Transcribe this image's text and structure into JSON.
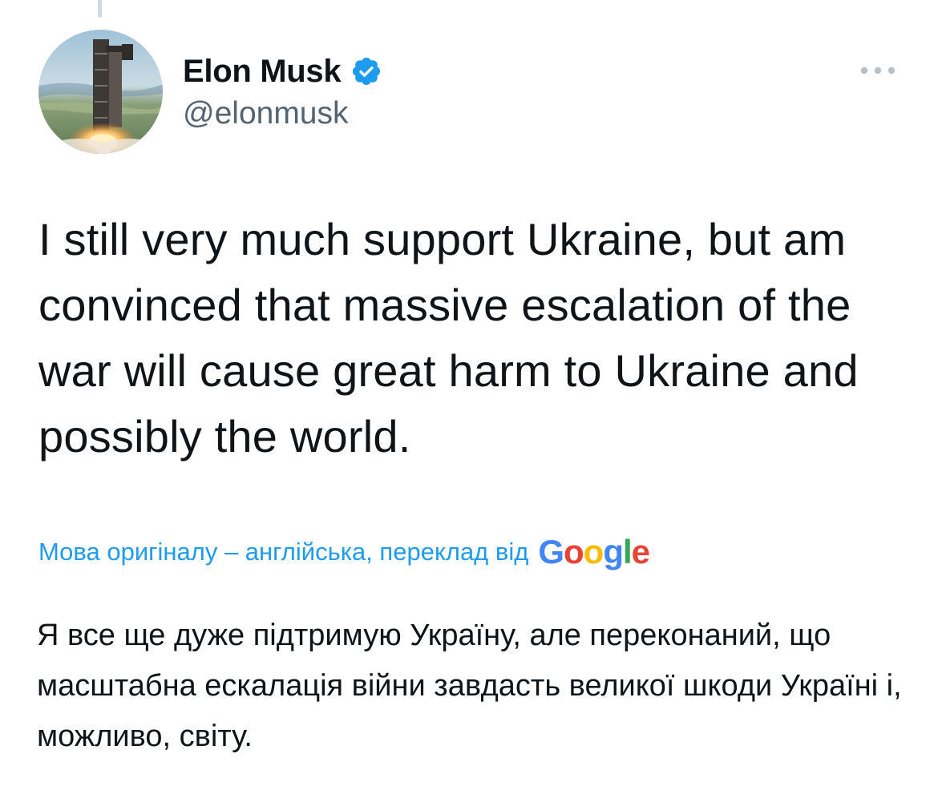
{
  "tweet": {
    "author": {
      "display_name": "Elon Musk",
      "handle": "@elonmusk",
      "verified": true,
      "avatar_icon": "rocket-launch-avatar",
      "verified_icon": "verified-badge-icon"
    },
    "more_icon": "more-options-icon",
    "text": "I still very much support Ukraine, but am convinced that massive escalation of the war will cause great harm to Ukraine and possibly the world.",
    "translation": {
      "label": "Мова оригіналу – англійська, переклад від",
      "provider": "Google",
      "text": "Я все ще дуже підтримую Україну, але переконаний, що масштабна ескалація війни завдасть великої шкоди Україні і, можливо, світу."
    }
  },
  "colors": {
    "text_primary": "#0f1419",
    "text_secondary": "#536471",
    "link": "#1d9bf0",
    "verified": "#1d9bf0",
    "google_blue": "#4285f4",
    "google_red": "#ea4335",
    "google_yellow": "#fbbc05",
    "google_green": "#34a853"
  }
}
